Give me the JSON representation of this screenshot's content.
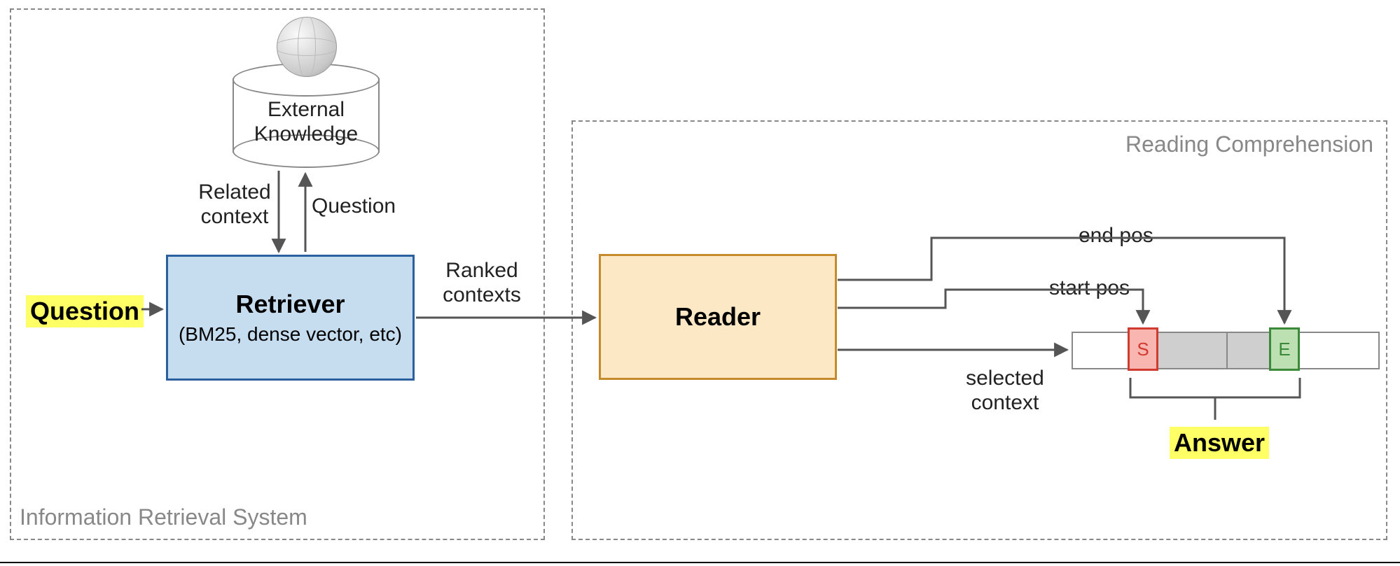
{
  "panels": {
    "ir_label": "Information Retrieval System",
    "rc_label": "Reading Comprehension"
  },
  "nodes": {
    "question": "Question",
    "retriever_title": "Retriever",
    "retriever_sub": "(BM25, dense vector, etc)",
    "reader_title": "Reader",
    "external_knowledge_l1": "External",
    "external_knowledge_l2": "Knowledge",
    "answer": "Answer"
  },
  "edges": {
    "related_context_l1": "Related",
    "related_context_l2": "context",
    "question_up": "Question",
    "ranked_l1": "Ranked",
    "ranked_l2": "contexts",
    "start_pos": "start pos",
    "end_pos": "end pos",
    "selected_l1": "selected",
    "selected_l2": "context"
  },
  "tokens": {
    "s": "S",
    "e": "E"
  }
}
